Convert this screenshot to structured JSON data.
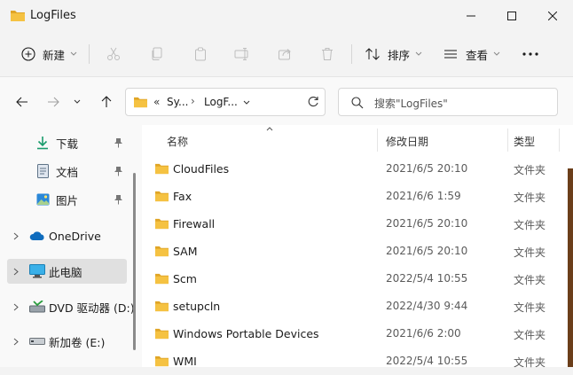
{
  "window": {
    "title": "LogFiles"
  },
  "toolbar": {
    "new_label": "新建",
    "sort_label": "排序",
    "view_label": "查看"
  },
  "address": {
    "overflow": "«",
    "segment1": "Sy...",
    "sep": "›",
    "segment2": "LogF..."
  },
  "search": {
    "placeholder": "搜索\"LogFiles\""
  },
  "sidebar": {
    "items": [
      {
        "label": "下载",
        "icon": "download-icon",
        "pinned": true
      },
      {
        "label": "文档",
        "icon": "document-icon",
        "pinned": true
      },
      {
        "label": "图片",
        "icon": "pictures-icon",
        "pinned": true
      },
      {
        "label": "OneDrive",
        "icon": "onedrive-icon"
      },
      {
        "label": "此电脑",
        "icon": "computer-icon",
        "selected": true
      },
      {
        "label": "DVD 驱动器 (D:)",
        "icon": "dvd-icon"
      },
      {
        "label": "新加卷 (E:)",
        "icon": "drive-icon"
      }
    ]
  },
  "columns": {
    "name": "名称",
    "date": "修改日期",
    "type": "类型"
  },
  "files": [
    {
      "name": "CloudFiles",
      "date": "2021/6/5 20:10",
      "type": "文件夹"
    },
    {
      "name": "Fax",
      "date": "2021/6/6 1:59",
      "type": "文件夹"
    },
    {
      "name": "Firewall",
      "date": "2021/6/5 20:10",
      "type": "文件夹"
    },
    {
      "name": "SAM",
      "date": "2021/6/5 20:10",
      "type": "文件夹"
    },
    {
      "name": "Scm",
      "date": "2022/5/4 10:55",
      "type": "文件夹"
    },
    {
      "name": "setupcln",
      "date": "2022/4/30 9:44",
      "type": "文件夹"
    },
    {
      "name": "Windows Portable Devices",
      "date": "2021/6/6 2:00",
      "type": "文件夹"
    },
    {
      "name": "WMI",
      "date": "2022/5/4 10:55",
      "type": "文件夹"
    }
  ],
  "colors": {
    "folder": "#f5c242",
    "folder_dark": "#e0a526",
    "accent": "#0067c0"
  }
}
